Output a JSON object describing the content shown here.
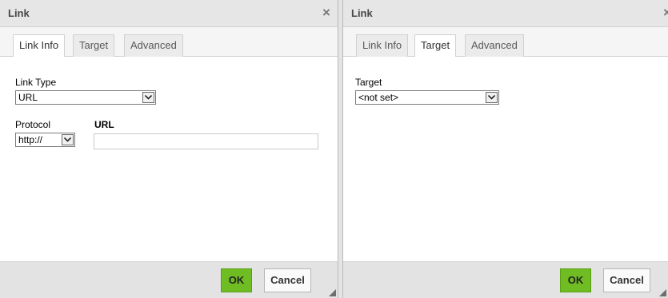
{
  "left_dialog": {
    "title": "Link",
    "close_glyph": "×",
    "tabs": [
      "Link Info",
      "Target",
      "Advanced"
    ],
    "active_tab": "Link Info",
    "link_type": {
      "label": "Link Type",
      "value": "URL"
    },
    "protocol": {
      "label": "Protocol",
      "value": "http://"
    },
    "url": {
      "label": "URL",
      "value": ""
    },
    "buttons": {
      "ok": "OK",
      "cancel": "Cancel"
    }
  },
  "right_dialog": {
    "title": "Link",
    "close_glyph": "×",
    "tabs": [
      "Link Info",
      "Target",
      "Advanced"
    ],
    "active_tab": "Target",
    "target": {
      "label": "Target",
      "value": "<not set>"
    },
    "buttons": {
      "ok": "OK",
      "cancel": "Cancel"
    }
  },
  "colors": {
    "ok_button": "#6fbd22",
    "titlebar": "#e6e6e6",
    "footer": "#e3e3e3"
  },
  "icons": [
    "close-icon",
    "chevron-down-icon",
    "resize-handle-icon"
  ]
}
